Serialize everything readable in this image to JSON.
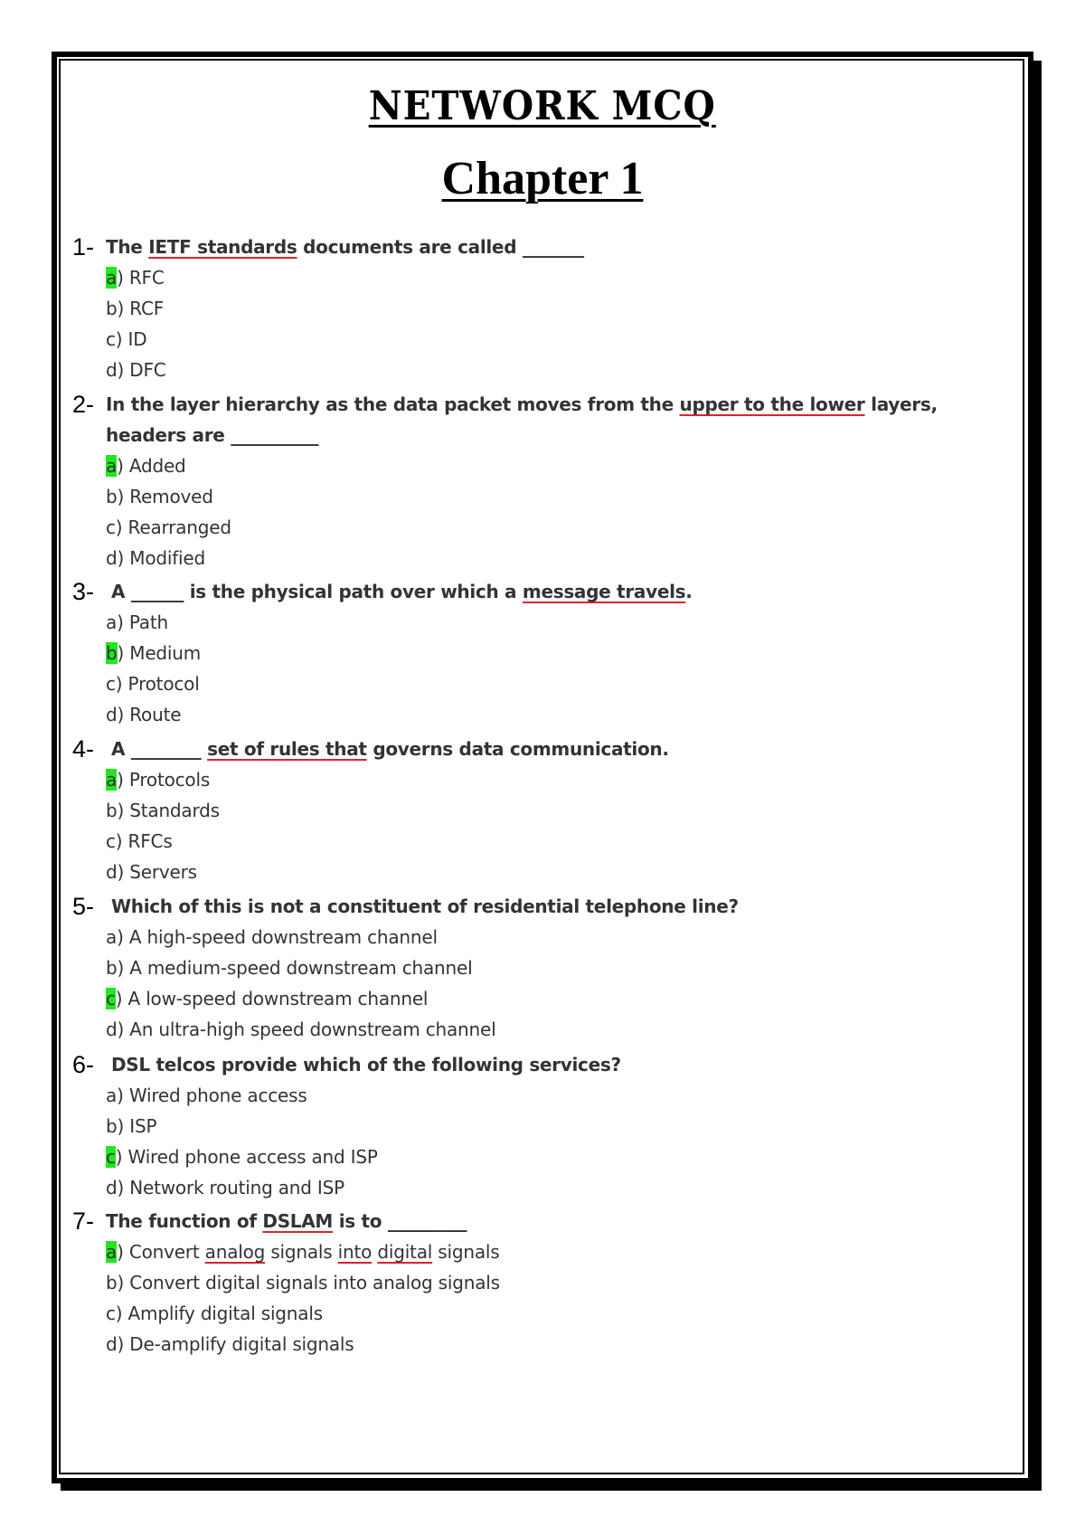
{
  "document": {
    "title": "NETWORK MCQ",
    "chapter": "Chapter 1"
  },
  "questions": [
    {
      "number": "1-",
      "parts": [
        {
          "text": "The ",
          "underline": false
        },
        {
          "text": "IETF standards",
          "underline": true
        },
        {
          "text": " documents are called _______",
          "underline": false
        }
      ],
      "options": [
        {
          "letter": "a",
          "text": ") RFC",
          "correct": true
        },
        {
          "letter": "b",
          "text": ") RCF",
          "correct": false
        },
        {
          "letter": "c",
          "text": ") ID",
          "correct": false
        },
        {
          "letter": "d",
          "text": ") DFC",
          "correct": false
        }
      ]
    },
    {
      "number": "2-",
      "parts": [
        {
          "text": "In the layer hierarchy as the data packet moves from the ",
          "underline": false
        },
        {
          "text": "upper to the lower",
          "underline": true
        },
        {
          "text": " layers, headers are __________",
          "underline": false
        }
      ],
      "options": [
        {
          "letter": "a",
          "text": ") Added",
          "correct": true
        },
        {
          "letter": "b",
          "text": ") Removed",
          "correct": false
        },
        {
          "letter": "c",
          "text": ") Rearranged",
          "correct": false
        },
        {
          "letter": "d",
          "text": ") Modified",
          "correct": false
        }
      ]
    },
    {
      "number": "3-",
      "parts": [
        {
          "text": "A ______ is the physical path over which a ",
          "underline": false
        },
        {
          "text": "message travels",
          "underline": true
        },
        {
          "text": ".",
          "underline": false
        }
      ],
      "options": [
        {
          "letter": "a",
          "text": ") Path",
          "correct": false
        },
        {
          "letter": "b",
          "text": ") Medium",
          "correct": true
        },
        {
          "letter": "c",
          "text": ") Protocol",
          "correct": false
        },
        {
          "letter": "d",
          "text": ") Route",
          "correct": false
        }
      ]
    },
    {
      "number": "4-",
      "parts": [
        {
          "text": "A ________ ",
          "underline": false
        },
        {
          "text": "set of rules that",
          "underline": true
        },
        {
          "text": " governs data communication.",
          "underline": false
        }
      ],
      "options": [
        {
          "letter": "a",
          "text": ") Protocols",
          "correct": true
        },
        {
          "letter": "b",
          "text": ") Standards",
          "correct": false
        },
        {
          "letter": "c",
          "text": ") RFCs",
          "correct": false
        },
        {
          "letter": "d",
          "text": ") Servers",
          "correct": false
        }
      ]
    },
    {
      "number": "5-",
      "parts": [
        {
          "text": "Which of this is not a constituent of residential telephone line?",
          "underline": false
        }
      ],
      "options": [
        {
          "letter": "a",
          "text": ") A high-speed downstream channel",
          "correct": false
        },
        {
          "letter": "b",
          "text": ") A medium-speed downstream channel",
          "correct": false
        },
        {
          "letter": "c",
          "text": ") A low-speed downstream channel",
          "correct": true
        },
        {
          "letter": "d",
          "text": ") An ultra-high speed downstream channel",
          "correct": false
        }
      ]
    },
    {
      "number": "6-",
      "parts": [
        {
          "text": "DSL telcos provide which of the following services?",
          "underline": false
        }
      ],
      "options": [
        {
          "letter": "a",
          "text": ") Wired phone access",
          "correct": false
        },
        {
          "letter": "b",
          "text": ") ISP",
          "correct": false
        },
        {
          "letter": "c",
          "text": ") Wired phone access and ISP",
          "correct": true
        },
        {
          "letter": "d",
          "text": ") Network routing and ISP",
          "correct": false
        }
      ]
    },
    {
      "number": "7-",
      "parts": [
        {
          "text": "The function of ",
          "underline": false
        },
        {
          "text": "DSLAM",
          "underline": true
        },
        {
          "text": " is to _________",
          "underline": false
        }
      ],
      "options": [
        {
          "letter": "a",
          "text": ") Convert analog signals into digital signals",
          "correct": true,
          "parts": [
            {
              "text": ") Convert ",
              "underline": false
            },
            {
              "text": "analog",
              "underline": true
            },
            {
              "text": " signals ",
              "underline": false
            },
            {
              "text": "into",
              "underline": true
            },
            {
              "text": " ",
              "underline": false
            },
            {
              "text": "digital",
              "underline": true
            },
            {
              "text": " signals",
              "underline": false
            }
          ]
        },
        {
          "letter": "b",
          "text": ") Convert digital signals into analog signals",
          "correct": false
        },
        {
          "letter": "c",
          "text": ") Amplify digital signals",
          "correct": false
        },
        {
          "letter": "d",
          "text": ") De-amplify digital signals",
          "correct": false
        }
      ]
    }
  ],
  "colors": {
    "answer_highlight": "#22e622",
    "spellcheck_underline": "#e0202f",
    "text": "#333333",
    "border": "#000000"
  }
}
